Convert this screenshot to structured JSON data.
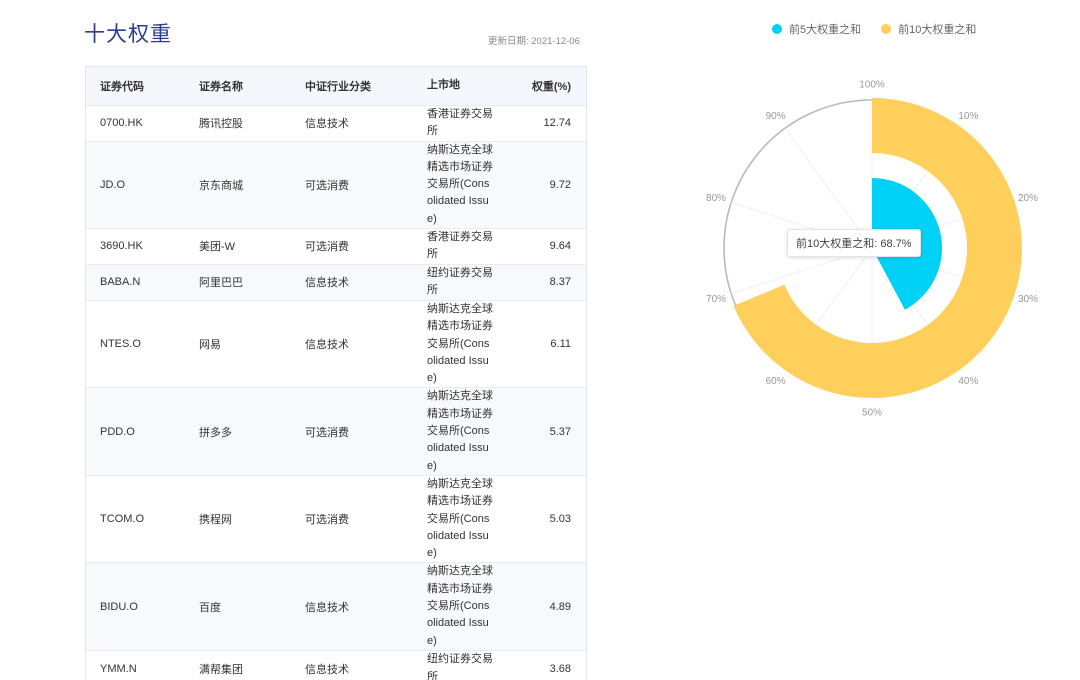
{
  "header": {
    "title": "十大权重",
    "update_date": "更新日期: 2021-12-06"
  },
  "table": {
    "columns": [
      "证券代码",
      "证券名称",
      "中证行业分类",
      "上市地",
      "权重(%)"
    ],
    "rows": [
      {
        "code": "0700.HK",
        "name": "腾讯控股",
        "industry": "信息技术",
        "exchange": "香港证券交易所",
        "weight": "12.74"
      },
      {
        "code": "JD.O",
        "name": "京东商城",
        "industry": "可选消费",
        "exchange": "纳斯达克全球精选市场证券交易所(Consolidated Issue)",
        "weight": "9.72"
      },
      {
        "code": "3690.HK",
        "name": "美团-W",
        "industry": "可选消费",
        "exchange": "香港证券交易所",
        "weight": "9.64"
      },
      {
        "code": "BABA.N",
        "name": "阿里巴巴",
        "industry": "信息技术",
        "exchange": "纽约证券交易所",
        "weight": "8.37"
      },
      {
        "code": "NTES.O",
        "name": "网易",
        "industry": "信息技术",
        "exchange": "纳斯达克全球精选市场证券交易所(Consolidated Issue)",
        "weight": "6.11"
      },
      {
        "code": "PDD.O",
        "name": "拼多多",
        "industry": "可选消费",
        "exchange": "纳斯达克全球精选市场证券交易所(Consolidated Issue)",
        "weight": "5.37"
      },
      {
        "code": "TCOM.O",
        "name": "携程网",
        "industry": "可选消费",
        "exchange": "纳斯达克全球精选市场证券交易所(Consolidated Issue)",
        "weight": "5.03"
      },
      {
        "code": "BIDU.O",
        "name": "百度",
        "industry": "信息技术",
        "exchange": "纳斯达克全球精选市场证券交易所(Consolidated Issue)",
        "weight": "4.89"
      },
      {
        "code": "YMM.N",
        "name": "满帮集团",
        "industry": "信息技术",
        "exchange": "纽约证券交易所",
        "weight": "3.68"
      }
    ]
  },
  "chart": {
    "legend": [
      {
        "label": "前5大权重之和",
        "color": "#00d1f5"
      },
      {
        "label": "前10大权重之和",
        "color": "#ffcf5c"
      }
    ],
    "tooltip": "前10大权重之和: 68.7%",
    "ticks": [
      "100%",
      "10%",
      "20%",
      "30%",
      "40%",
      "50%",
      "60%",
      "70%",
      "80%",
      "90%"
    ]
  },
  "chart_data": {
    "type": "bar",
    "polar": true,
    "categories": [
      "前5大权重之和",
      "前10大权重之和"
    ],
    "values": [
      42.2,
      68.7
    ],
    "colors": [
      "#00d1f5",
      "#ffcf5c"
    ],
    "angle_axis_range": [
      0,
      100
    ],
    "angle_ticks": [
      "100%",
      "10%",
      "20%",
      "30%",
      "40%",
      "50%",
      "60%",
      "70%",
      "80%",
      "90%"
    ]
  }
}
